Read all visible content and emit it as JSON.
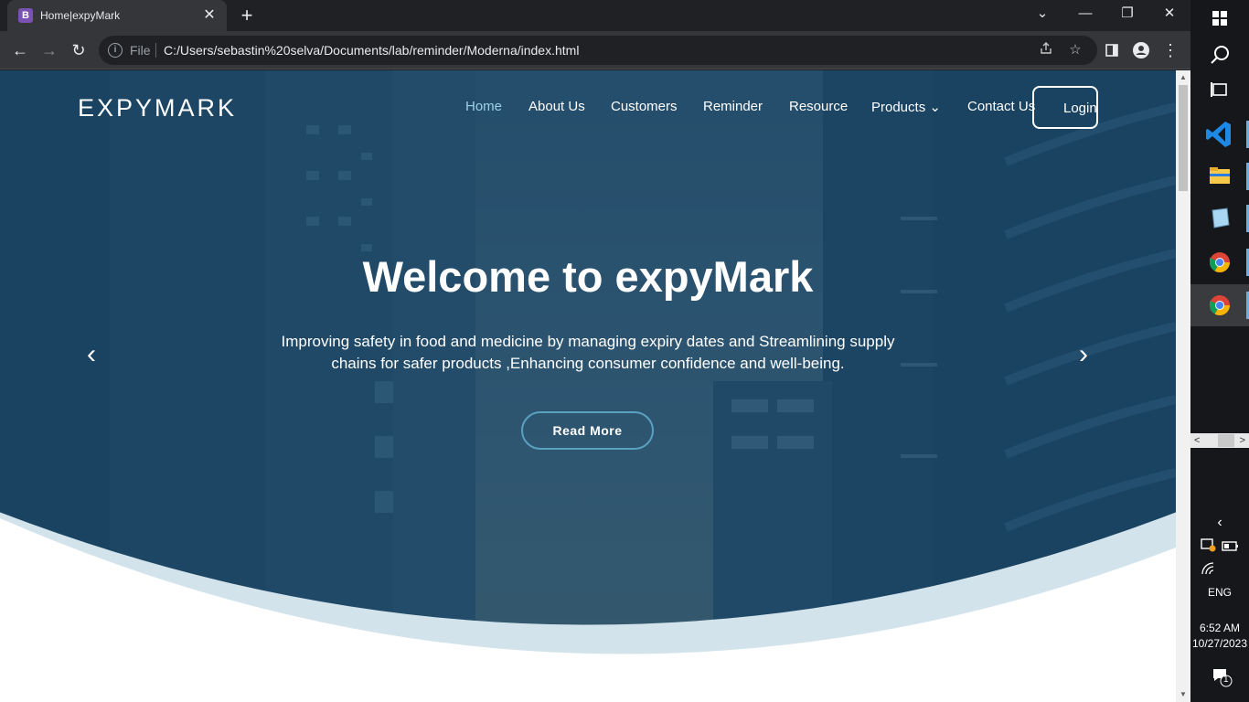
{
  "browser": {
    "tab": {
      "favicon_letter": "B",
      "title": "Home|expyMark",
      "close": "✕"
    },
    "new_tab": "+",
    "window_controls": {
      "tab_search": "⌄",
      "minimize": "—",
      "restore": "❐",
      "close": "✕"
    },
    "toolbar": {
      "back": "←",
      "forward": "→",
      "reload": "↻",
      "info": "i",
      "scheme_label": "File",
      "url": "C:/Users/sebastin%20selva/Documents/lab/reminder/Moderna/index.html"
    }
  },
  "site": {
    "brand": "EXPYMARK",
    "nav": [
      {
        "label": "Home",
        "active": true
      },
      {
        "label": "About Us"
      },
      {
        "label": "Customers"
      },
      {
        "label": "Reminder"
      },
      {
        "label": "Resource"
      },
      {
        "label": "Products ⌄"
      },
      {
        "label": "Contact Us"
      }
    ],
    "login": "Login",
    "hero": {
      "title": "Welcome to expyMark",
      "text": "Improving safety in food and medicine by managing expiry dates and Streamlining supply chains for safer products ,Enhancing consumer confidence and well-being.",
      "button": "Read More",
      "prev": "‹",
      "next": "›"
    },
    "colors": {
      "hero_overlay": "#1f4e6c",
      "wave": "#d3e3ec",
      "nav_active": "#9cd2e6",
      "accent": "#5aa0c0"
    }
  },
  "taskbar": {
    "language": "ENG",
    "time": "6:52 AM",
    "date": "10/27/2023",
    "notification_count": "1",
    "apps": [
      "windows-start-icon",
      "search-icon",
      "task-view-icon",
      "vscode-icon",
      "file-explorer-icon",
      "notepad-icon",
      "chrome-icon",
      "chrome-icon"
    ]
  }
}
